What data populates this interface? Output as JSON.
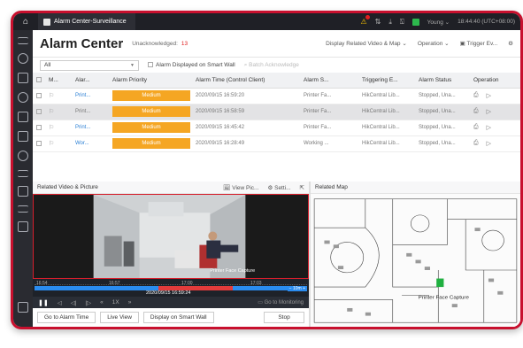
{
  "topbar": {
    "tab_title": "Alarm Center-Surveillance",
    "user": "Young",
    "time": "18:44:40 (UTC+08:00)"
  },
  "header": {
    "title": "Alarm Center",
    "unack_label": "Unacknowledged:",
    "unack_count": "13",
    "display_related": "Display Related Video & Map",
    "operation": "Operation",
    "trigger": "Trigger Ev..."
  },
  "filter": {
    "select_value": "All",
    "smartwall_label": "Alarm Displayed on Smart Wall",
    "batch_label": "Batch Acknowledge"
  },
  "table": {
    "columns": [
      "M...",
      "Alar...",
      "Alarm Priority",
      "Alarm Time (Control Client)",
      "Alarm S...",
      "Triggering E...",
      "Alarm Status",
      "Operation"
    ],
    "rows": [
      {
        "source": "Print...",
        "priority": "Medium",
        "time": "2020/09/15 16:59:20",
        "alarm_source": "Printer Fa...",
        "trigger": "HikCentral Lib...",
        "status": "Stopped, Una...",
        "link": true,
        "selected": false
      },
      {
        "source": "Print...",
        "priority": "Medium",
        "time": "2020/09/15 16:58:59",
        "alarm_source": "Printer Fa...",
        "trigger": "HikCentral Lib...",
        "status": "Stopped, Una...",
        "link": false,
        "selected": true
      },
      {
        "source": "Print...",
        "priority": "Medium",
        "time": "2020/09/15 16:45:42",
        "alarm_source": "Printer Fa...",
        "trigger": "HikCentral Lib...",
        "status": "Stopped, Una...",
        "link": true,
        "selected": false
      },
      {
        "source": "Wor...",
        "priority": "Medium",
        "time": "2020/09/15 16:28:49",
        "alarm_source": "Working ...",
        "trigger": "HikCentral Lib...",
        "status": "Stopped, Una...",
        "link": true,
        "selected": false
      }
    ]
  },
  "video_panel": {
    "title": "Related Video & Picture",
    "view_pic": "View Pic...",
    "settings": "Setti...",
    "overlay_text": "Printer Face Capture",
    "timeline_labels": [
      "16:54",
      "16:57",
      "17:00",
      "17:03"
    ],
    "current_time": "2020/09/15 16:59:24",
    "zoom": "10m",
    "speed": "1X",
    "go_monitoring": "Go to Monitoring",
    "buttons": {
      "go_alarm_time": "Go to Alarm Time",
      "live_view": "Live View",
      "display_smart_wall": "Display on Smart Wall",
      "stop": "Stop"
    }
  },
  "map_panel": {
    "title": "Related Map",
    "marker_label": "Printer Face Capture"
  },
  "colors": {
    "accent": "#c8102e",
    "priority_medium": "#f5a623",
    "link": "#2a7fd4",
    "timeline": "#2a8cf0"
  }
}
